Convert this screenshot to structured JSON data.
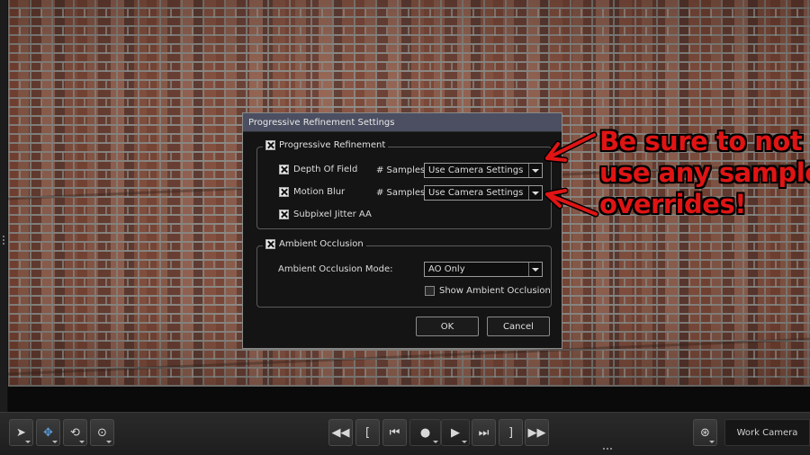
{
  "dialog": {
    "title": "Progressive Refinement Settings",
    "progressive_group": {
      "label": "Progressive Refinement",
      "checked": true,
      "depth_of_field": {
        "label": "Depth Of Field",
        "checked": true,
        "samples_label": "# Samples",
        "value": "Use Camera Settings"
      },
      "motion_blur": {
        "label": "Motion Blur",
        "checked": true,
        "samples_label": "# Samples",
        "value": "Use Camera Settings"
      },
      "subpixel": {
        "label": "Subpixel Jitter AA",
        "checked": true
      }
    },
    "ao_group": {
      "label": "Ambient Occlusion",
      "checked": true,
      "mode_label": "Ambient Occlusion Mode:",
      "mode_value": "AO Only",
      "show_ao": {
        "label": "Show Ambient Occlusion",
        "checked": false
      }
    },
    "ok_label": "OK",
    "cancel_label": "Cancel"
  },
  "annotation": {
    "lines": [
      "Be sure to not",
      "use any sample",
      "overrides!"
    ],
    "color": "#e01414"
  },
  "toolbar": {
    "camera_label": "Work Camera"
  }
}
